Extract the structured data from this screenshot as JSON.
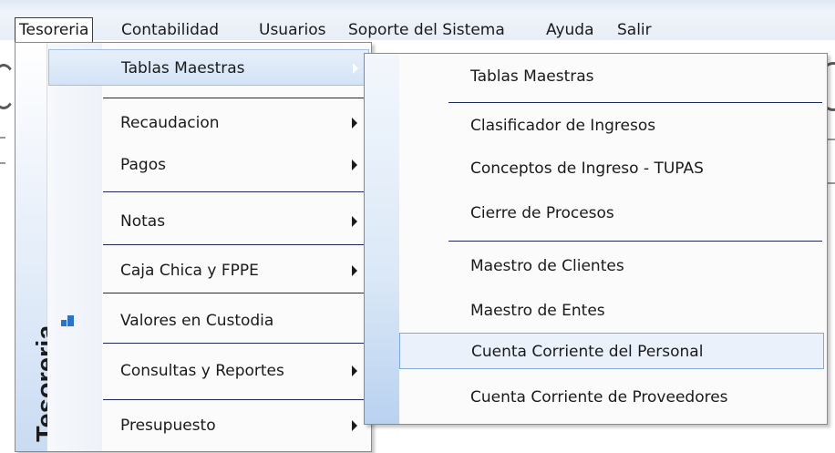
{
  "menubar": {
    "items": [
      "Tesoreria",
      "Contabilidad",
      "Usuarios",
      "Soporte del Sistema",
      "Ayuda",
      "Salir"
    ],
    "open_item": "Tesoreria"
  },
  "tesoreria_menu": {
    "sidebar_title": "Tesoreria",
    "items": [
      {
        "label": "Tablas Maestras",
        "submenu": true,
        "highlighted": true
      },
      {
        "label": "Recaudacion",
        "submenu": true
      },
      {
        "label": "Pagos",
        "submenu": true
      },
      {
        "label": "Notas",
        "submenu": true
      },
      {
        "label": "Caja Chica y FPPE",
        "submenu": true
      },
      {
        "label": "Valores en Custodia",
        "submenu": false,
        "icon": "custody-icon"
      },
      {
        "label": "Consultas y Reportes",
        "submenu": true
      },
      {
        "label": "Presupuesto",
        "submenu": true
      }
    ]
  },
  "tablas_maestras_submenu": {
    "items": [
      {
        "label": "Tablas Maestras"
      },
      {
        "label": "Clasificador de Ingresos"
      },
      {
        "label": "Conceptos de Ingreso - TUPAS"
      },
      {
        "label": "Cierre de Procesos"
      },
      {
        "label": "Maestro de Clientes"
      },
      {
        "label": "Maestro de Entes"
      },
      {
        "label": "Cuenta Corriente del Personal",
        "highlighted": true
      },
      {
        "label": "Cuenta Corriente de Proveedores"
      }
    ]
  },
  "colors": {
    "highlight_bg": "#d3e3f6",
    "highlight_border": "#9fbfe3",
    "separator": "#1e2a5a",
    "icon_blue": "#2a73c9"
  }
}
